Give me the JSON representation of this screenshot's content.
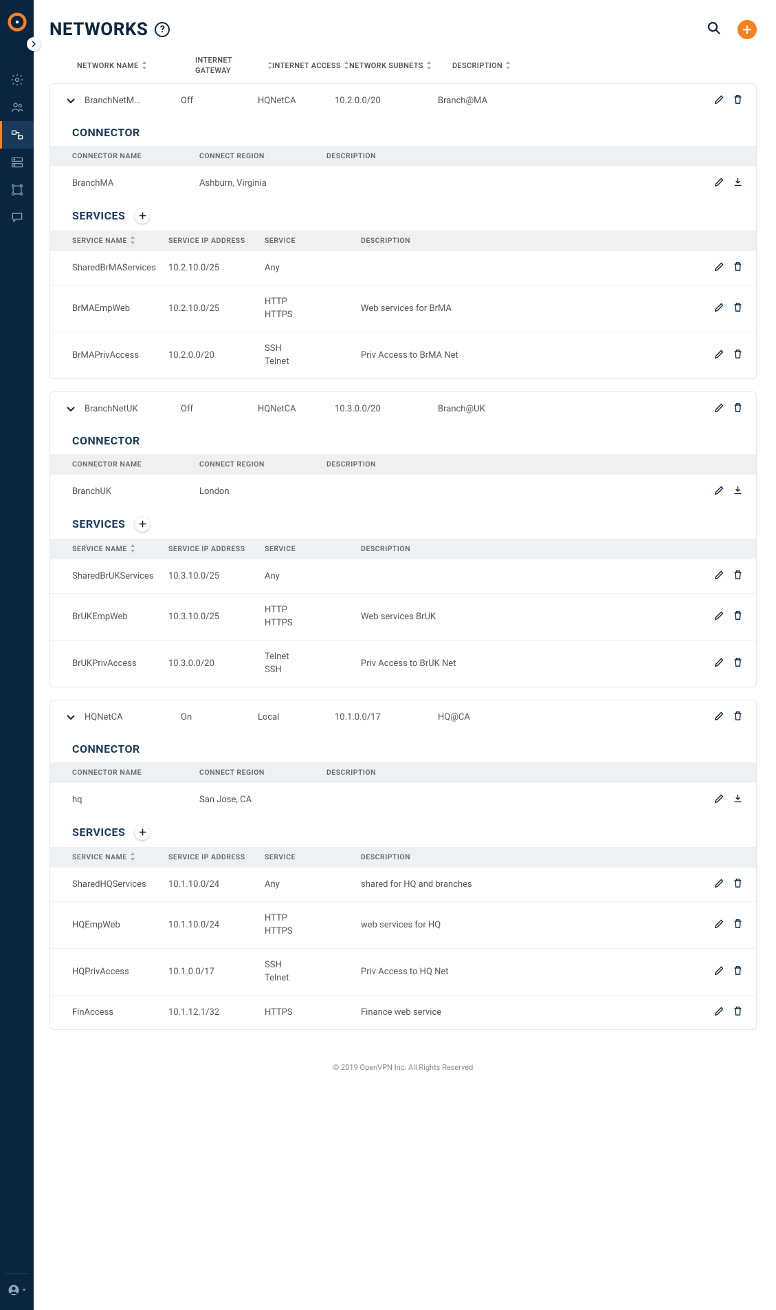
{
  "page_title": "NETWORKS",
  "columns": {
    "name": "NETWORK NAME",
    "gateway": "INTERNET GATEWAY",
    "access": "INTERNET ACCESS",
    "subnets": "NETWORK SUBNETS",
    "description": "DESCRIPTION"
  },
  "section_labels": {
    "connector": "CONNECTOR",
    "services": "SERVICES"
  },
  "connector_cols": {
    "name": "CONNECTOR NAME",
    "region": "CONNECT REGION",
    "description": "DESCRIPTION"
  },
  "service_cols": {
    "name": "SERVICE NAME",
    "ip": "SERVICE IP ADDRESS",
    "service": "SERVICE",
    "description": "DESCRIPTION"
  },
  "networks": [
    {
      "name": "BranchNetM…",
      "gateway": "Off",
      "access": "HQNetCA",
      "subnets": "10.2.0.0/20",
      "description": "Branch@MA",
      "connectors": [
        {
          "name": "BranchMA",
          "region": "Ashburn, Virginia",
          "description": ""
        }
      ],
      "services": [
        {
          "name": "SharedBrMAServices",
          "ip": "10.2.10.0/25",
          "service": [
            "Any"
          ],
          "description": ""
        },
        {
          "name": "BrMAEmpWeb",
          "ip": "10.2.10.0/25",
          "service": [
            "HTTP",
            "HTTPS"
          ],
          "description": "Web services for BrMA"
        },
        {
          "name": "BrMAPrivAccess",
          "ip": "10.2.0.0/20",
          "service": [
            "SSH",
            "Telnet"
          ],
          "description": "Priv Access to BrMA Net"
        }
      ]
    },
    {
      "name": "BranchNetUK",
      "gateway": "Off",
      "access": "HQNetCA",
      "subnets": "10.3.0.0/20",
      "description": "Branch@UK",
      "connectors": [
        {
          "name": "BranchUK",
          "region": "London",
          "description": ""
        }
      ],
      "services": [
        {
          "name": "SharedBrUKServices",
          "ip": "10.3.10.0/25",
          "service": [
            "Any"
          ],
          "description": ""
        },
        {
          "name": "BrUKEmpWeb",
          "ip": "10.3.10.0/25",
          "service": [
            "HTTP",
            "HTTPS"
          ],
          "description": "Web services BrUK"
        },
        {
          "name": "BrUKPrivAccess",
          "ip": "10.3.0.0/20",
          "service": [
            "Telnet",
            "SSH"
          ],
          "description": "Priv Access to BrUK Net"
        }
      ]
    },
    {
      "name": "HQNetCA",
      "gateway": "On",
      "access": "Local",
      "subnets": "10.1.0.0/17",
      "description": "HQ@CA",
      "connectors": [
        {
          "name": "hq",
          "region": "San Jose, CA",
          "description": ""
        }
      ],
      "services": [
        {
          "name": "SharedHQServices",
          "ip": "10.1.10.0/24",
          "service": [
            "Any"
          ],
          "description": "shared for HQ and branches"
        },
        {
          "name": "HQEmpWeb",
          "ip": "10.1.10.0/24",
          "service": [
            "HTTP",
            "HTTPS"
          ],
          "description": "web services for HQ"
        },
        {
          "name": "HQPrivAccess",
          "ip": "10.1.0.0/17",
          "service": [
            "SSH",
            "Telnet"
          ],
          "description": "Priv Access to HQ Net"
        },
        {
          "name": "FinAccess",
          "ip": "10.1.12.1/32",
          "service": [
            "HTTPS"
          ],
          "description": "Finance web service"
        }
      ]
    }
  ],
  "footer": "© 2019 OpenVPN Inc. All Rights Reserved"
}
